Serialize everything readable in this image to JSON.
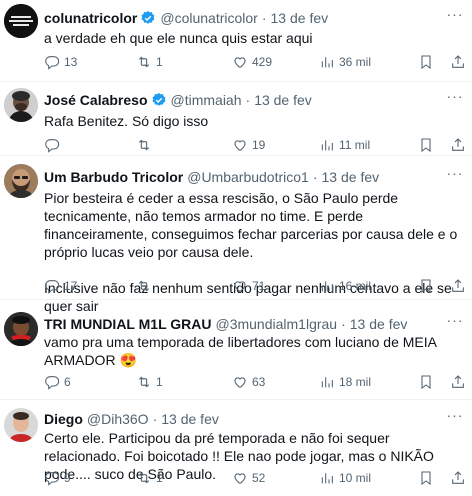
{
  "tweets": [
    {
      "name": "colunatricolor",
      "handle": "@colunatricolor",
      "date": "13 de fev",
      "verified": true,
      "avatar_text": "COLUNA TRICOLOR",
      "paragraphs": [
        "a verdade eh que ele nunca quis estar aqui"
      ],
      "replies": "13",
      "retweets": "1",
      "likes": "429",
      "views": "36 mil"
    },
    {
      "name": "José Calabreso",
      "handle": "@timmaiah",
      "date": "13 de fev",
      "verified": true,
      "paragraphs": [
        "Rafa Benitez. Só digo isso"
      ],
      "replies": "",
      "retweets": "",
      "likes": "19",
      "views": "11 mil"
    },
    {
      "name": "Um Barbudo Tricolor",
      "handle": "@Umbarbudotrico1",
      "date": "13 de fev",
      "verified": false,
      "paragraphs": [
        "Pior besteira é ceder a essa rescisão, o São Paulo perde tecnicamente, não temos armador no time. E perde financeiramente, conseguimos fechar parcerias por causa dele e o próprio lucas veio por causa dele.",
        "Inclusive não faz nenhum sentido pagar nenhum centavo a ele se quer sair"
      ],
      "replies": "17",
      "retweets": "",
      "likes": "71",
      "views": "16 mil"
    },
    {
      "name": "TRI MUNDIAL M1L GRAU",
      "handle": "@3mundialm1lgrau",
      "date": "13 de fev",
      "verified": false,
      "paragraphs": [
        "vamo pra uma temporada de libertadores com luciano de MEIA ARMADOR 😍"
      ],
      "replies": "6",
      "retweets": "1",
      "likes": "63",
      "views": "18 mil"
    },
    {
      "name": "Diego",
      "handle": "@Dih36O",
      "date": "13 de fev",
      "verified": false,
      "paragraphs": [
        "Certo ele. Participou da pré temporada e não foi sequer relacionado. Foi boicotado !! Ele nao pode jogar, mas o NIKÃO pode.... suco de São Paulo."
      ],
      "replies": "9",
      "retweets": "1",
      "likes": "52",
      "views": "10 mil"
    }
  ],
  "colors": {
    "text": "#0f1419",
    "secondary": "#536471",
    "verified": "#1d9bf0",
    "divider": "#eff3f4"
  }
}
